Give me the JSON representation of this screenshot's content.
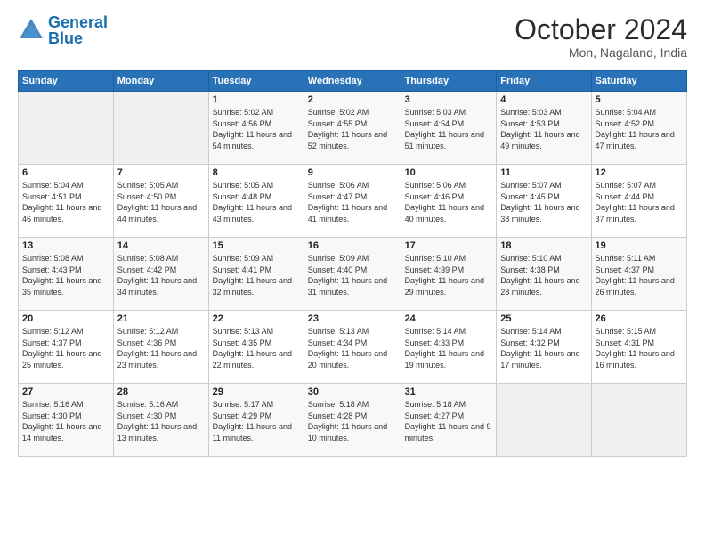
{
  "header": {
    "logo_line1": "General",
    "logo_line2": "Blue",
    "month": "October 2024",
    "location": "Mon, Nagaland, India"
  },
  "days_of_week": [
    "Sunday",
    "Monday",
    "Tuesday",
    "Wednesday",
    "Thursday",
    "Friday",
    "Saturday"
  ],
  "weeks": [
    [
      {
        "day": "",
        "sunrise": "",
        "sunset": "",
        "daylight": ""
      },
      {
        "day": "",
        "sunrise": "",
        "sunset": "",
        "daylight": ""
      },
      {
        "day": "1",
        "sunrise": "Sunrise: 5:02 AM",
        "sunset": "Sunset: 4:56 PM",
        "daylight": "Daylight: 11 hours and 54 minutes."
      },
      {
        "day": "2",
        "sunrise": "Sunrise: 5:02 AM",
        "sunset": "Sunset: 4:55 PM",
        "daylight": "Daylight: 11 hours and 52 minutes."
      },
      {
        "day": "3",
        "sunrise": "Sunrise: 5:03 AM",
        "sunset": "Sunset: 4:54 PM",
        "daylight": "Daylight: 11 hours and 51 minutes."
      },
      {
        "day": "4",
        "sunrise": "Sunrise: 5:03 AM",
        "sunset": "Sunset: 4:53 PM",
        "daylight": "Daylight: 11 hours and 49 minutes."
      },
      {
        "day": "5",
        "sunrise": "Sunrise: 5:04 AM",
        "sunset": "Sunset: 4:52 PM",
        "daylight": "Daylight: 11 hours and 47 minutes."
      }
    ],
    [
      {
        "day": "6",
        "sunrise": "Sunrise: 5:04 AM",
        "sunset": "Sunset: 4:51 PM",
        "daylight": "Daylight: 11 hours and 46 minutes."
      },
      {
        "day": "7",
        "sunrise": "Sunrise: 5:05 AM",
        "sunset": "Sunset: 4:50 PM",
        "daylight": "Daylight: 11 hours and 44 minutes."
      },
      {
        "day": "8",
        "sunrise": "Sunrise: 5:05 AM",
        "sunset": "Sunset: 4:48 PM",
        "daylight": "Daylight: 11 hours and 43 minutes."
      },
      {
        "day": "9",
        "sunrise": "Sunrise: 5:06 AM",
        "sunset": "Sunset: 4:47 PM",
        "daylight": "Daylight: 11 hours and 41 minutes."
      },
      {
        "day": "10",
        "sunrise": "Sunrise: 5:06 AM",
        "sunset": "Sunset: 4:46 PM",
        "daylight": "Daylight: 11 hours and 40 minutes."
      },
      {
        "day": "11",
        "sunrise": "Sunrise: 5:07 AM",
        "sunset": "Sunset: 4:45 PM",
        "daylight": "Daylight: 11 hours and 38 minutes."
      },
      {
        "day": "12",
        "sunrise": "Sunrise: 5:07 AM",
        "sunset": "Sunset: 4:44 PM",
        "daylight": "Daylight: 11 hours and 37 minutes."
      }
    ],
    [
      {
        "day": "13",
        "sunrise": "Sunrise: 5:08 AM",
        "sunset": "Sunset: 4:43 PM",
        "daylight": "Daylight: 11 hours and 35 minutes."
      },
      {
        "day": "14",
        "sunrise": "Sunrise: 5:08 AM",
        "sunset": "Sunset: 4:42 PM",
        "daylight": "Daylight: 11 hours and 34 minutes."
      },
      {
        "day": "15",
        "sunrise": "Sunrise: 5:09 AM",
        "sunset": "Sunset: 4:41 PM",
        "daylight": "Daylight: 11 hours and 32 minutes."
      },
      {
        "day": "16",
        "sunrise": "Sunrise: 5:09 AM",
        "sunset": "Sunset: 4:40 PM",
        "daylight": "Daylight: 11 hours and 31 minutes."
      },
      {
        "day": "17",
        "sunrise": "Sunrise: 5:10 AM",
        "sunset": "Sunset: 4:39 PM",
        "daylight": "Daylight: 11 hours and 29 minutes."
      },
      {
        "day": "18",
        "sunrise": "Sunrise: 5:10 AM",
        "sunset": "Sunset: 4:38 PM",
        "daylight": "Daylight: 11 hours and 28 minutes."
      },
      {
        "day": "19",
        "sunrise": "Sunrise: 5:11 AM",
        "sunset": "Sunset: 4:37 PM",
        "daylight": "Daylight: 11 hours and 26 minutes."
      }
    ],
    [
      {
        "day": "20",
        "sunrise": "Sunrise: 5:12 AM",
        "sunset": "Sunset: 4:37 PM",
        "daylight": "Daylight: 11 hours and 25 minutes."
      },
      {
        "day": "21",
        "sunrise": "Sunrise: 5:12 AM",
        "sunset": "Sunset: 4:36 PM",
        "daylight": "Daylight: 11 hours and 23 minutes."
      },
      {
        "day": "22",
        "sunrise": "Sunrise: 5:13 AM",
        "sunset": "Sunset: 4:35 PM",
        "daylight": "Daylight: 11 hours and 22 minutes."
      },
      {
        "day": "23",
        "sunrise": "Sunrise: 5:13 AM",
        "sunset": "Sunset: 4:34 PM",
        "daylight": "Daylight: 11 hours and 20 minutes."
      },
      {
        "day": "24",
        "sunrise": "Sunrise: 5:14 AM",
        "sunset": "Sunset: 4:33 PM",
        "daylight": "Daylight: 11 hours and 19 minutes."
      },
      {
        "day": "25",
        "sunrise": "Sunrise: 5:14 AM",
        "sunset": "Sunset: 4:32 PM",
        "daylight": "Daylight: 11 hours and 17 minutes."
      },
      {
        "day": "26",
        "sunrise": "Sunrise: 5:15 AM",
        "sunset": "Sunset: 4:31 PM",
        "daylight": "Daylight: 11 hours and 16 minutes."
      }
    ],
    [
      {
        "day": "27",
        "sunrise": "Sunrise: 5:16 AM",
        "sunset": "Sunset: 4:30 PM",
        "daylight": "Daylight: 11 hours and 14 minutes."
      },
      {
        "day": "28",
        "sunrise": "Sunrise: 5:16 AM",
        "sunset": "Sunset: 4:30 PM",
        "daylight": "Daylight: 11 hours and 13 minutes."
      },
      {
        "day": "29",
        "sunrise": "Sunrise: 5:17 AM",
        "sunset": "Sunset: 4:29 PM",
        "daylight": "Daylight: 11 hours and 11 minutes."
      },
      {
        "day": "30",
        "sunrise": "Sunrise: 5:18 AM",
        "sunset": "Sunset: 4:28 PM",
        "daylight": "Daylight: 11 hours and 10 minutes."
      },
      {
        "day": "31",
        "sunrise": "Sunrise: 5:18 AM",
        "sunset": "Sunset: 4:27 PM",
        "daylight": "Daylight: 11 hours and 9 minutes."
      },
      {
        "day": "",
        "sunrise": "",
        "sunset": "",
        "daylight": ""
      },
      {
        "day": "",
        "sunrise": "",
        "sunset": "",
        "daylight": ""
      }
    ]
  ]
}
